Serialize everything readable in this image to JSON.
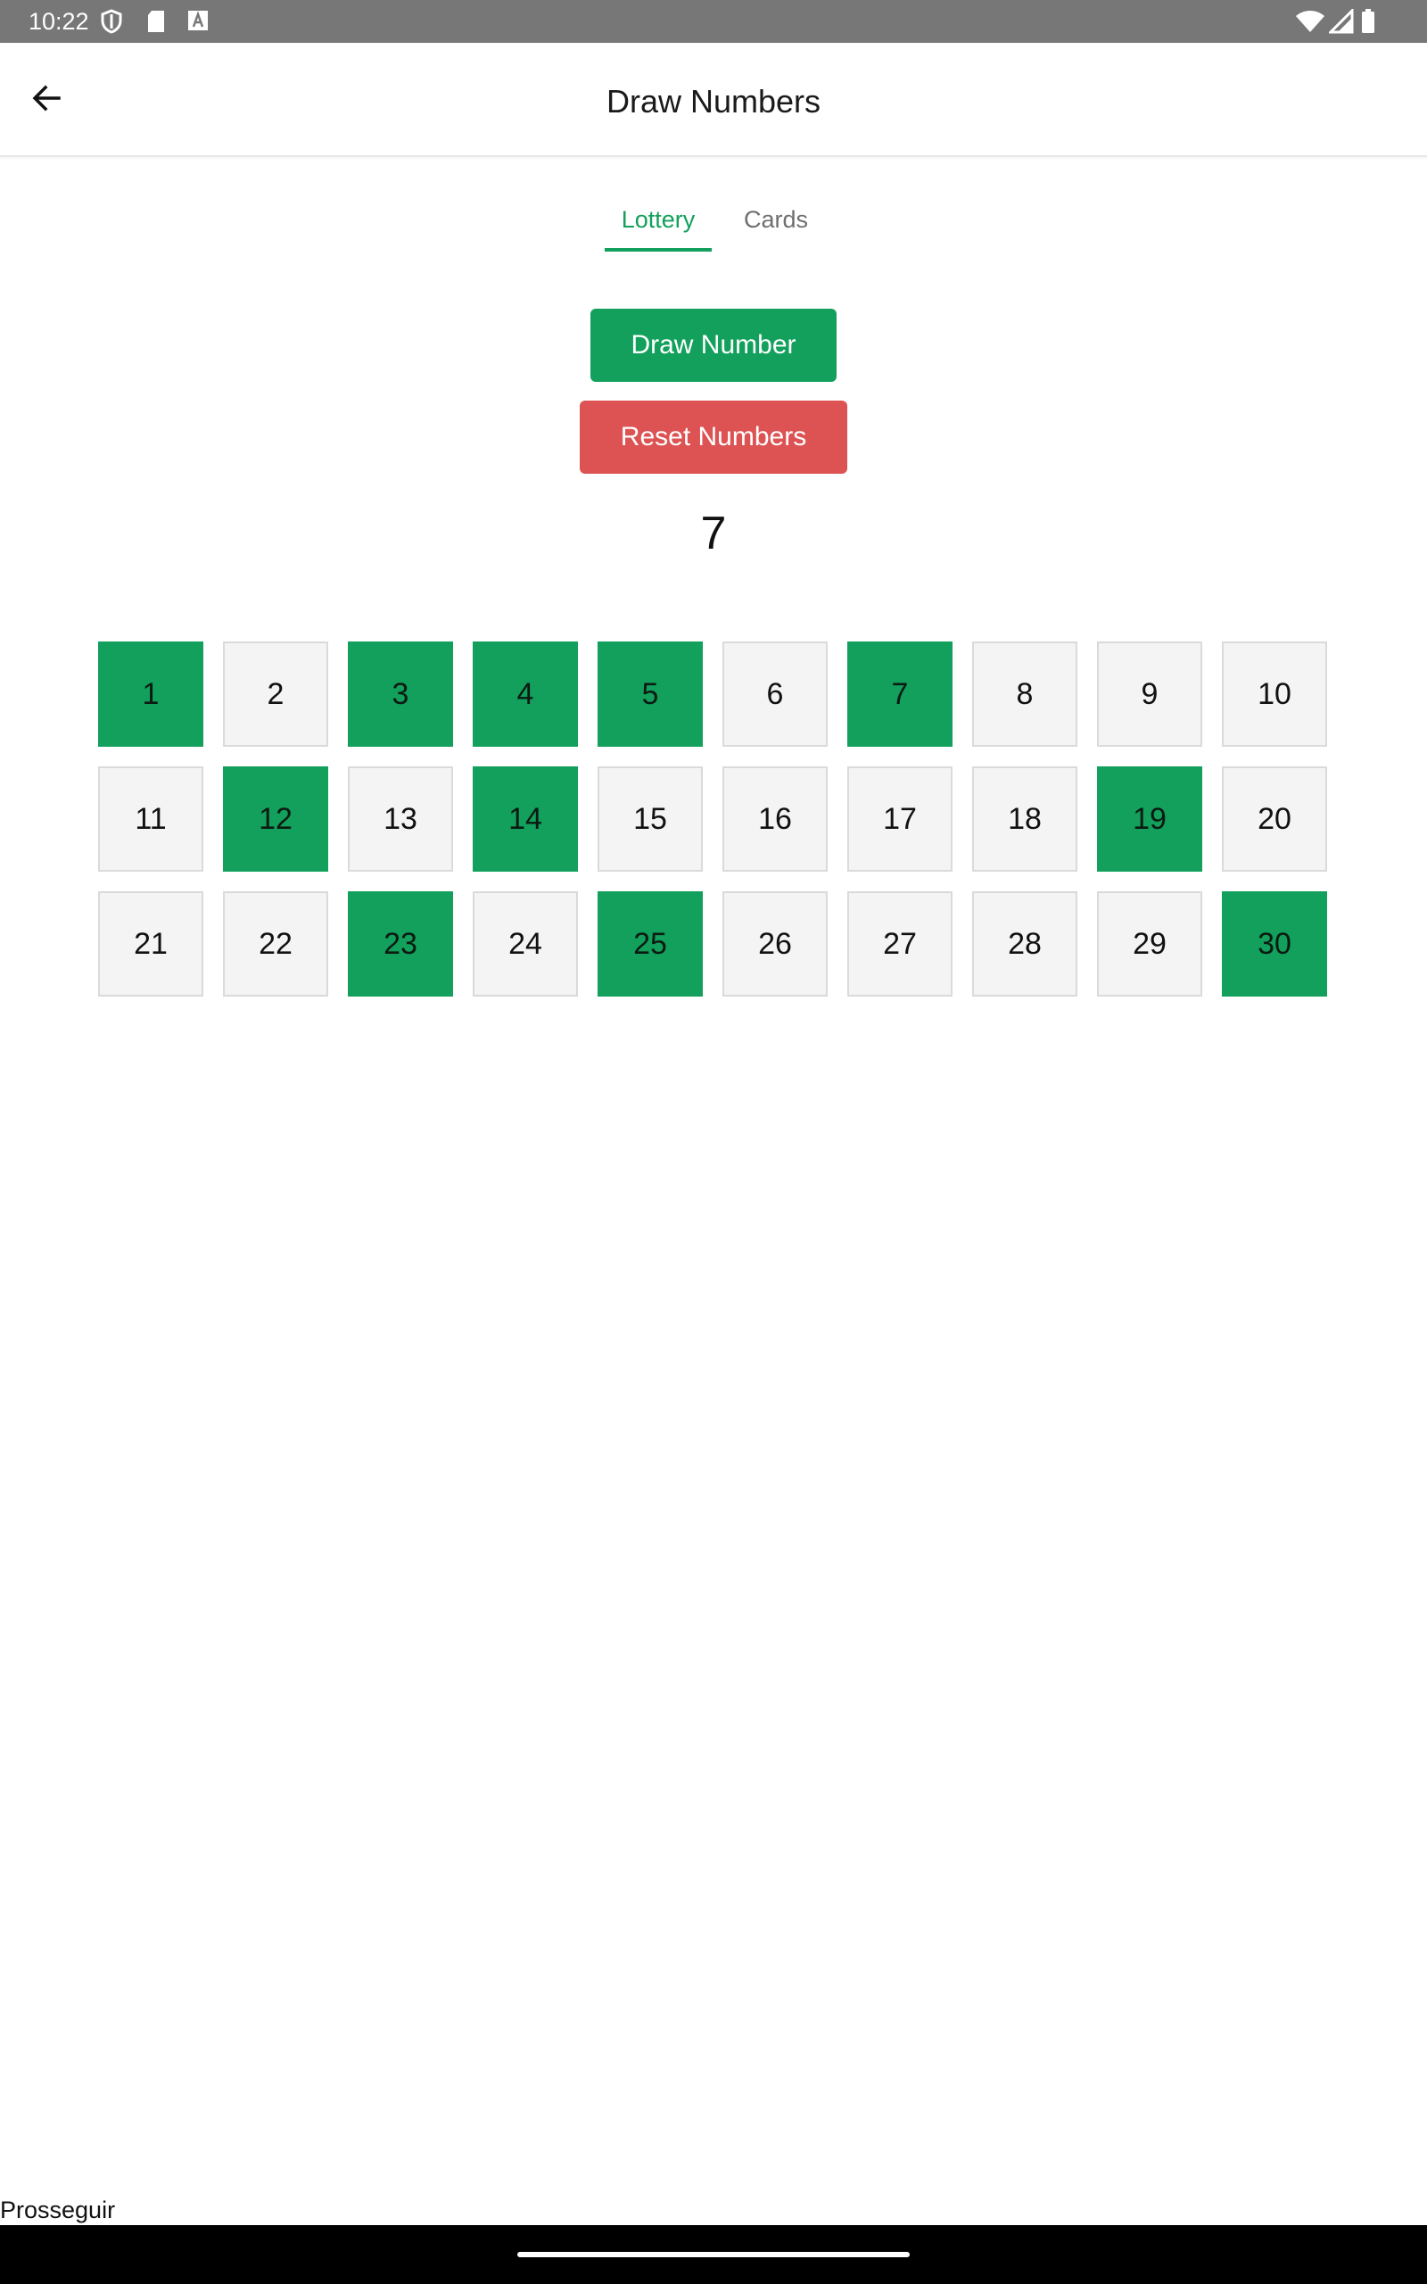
{
  "status_bar": {
    "time": "10:22",
    "left_icons": [
      "shield-icon",
      "sd-card-icon",
      "text-a-icon"
    ],
    "right_icons": [
      "wifi-icon",
      "signal-icon",
      "battery-icon"
    ]
  },
  "app_bar": {
    "title": "Draw Numbers",
    "back_icon": "arrow-left-icon"
  },
  "tabs": [
    {
      "label": "Lottery",
      "active": true
    },
    {
      "label": "Cards",
      "active": false
    }
  ],
  "actions": {
    "draw_label": "Draw Number",
    "reset_label": "Reset Numbers"
  },
  "current_number": "7",
  "numbers": [
    {
      "value": "1",
      "drawn": true
    },
    {
      "value": "2",
      "drawn": false
    },
    {
      "value": "3",
      "drawn": true
    },
    {
      "value": "4",
      "drawn": true
    },
    {
      "value": "5",
      "drawn": true
    },
    {
      "value": "6",
      "drawn": false
    },
    {
      "value": "7",
      "drawn": true
    },
    {
      "value": "8",
      "drawn": false
    },
    {
      "value": "9",
      "drawn": false
    },
    {
      "value": "10",
      "drawn": false
    },
    {
      "value": "11",
      "drawn": false
    },
    {
      "value": "12",
      "drawn": true
    },
    {
      "value": "13",
      "drawn": false
    },
    {
      "value": "14",
      "drawn": true
    },
    {
      "value": "15",
      "drawn": false
    },
    {
      "value": "16",
      "drawn": false
    },
    {
      "value": "17",
      "drawn": false
    },
    {
      "value": "18",
      "drawn": false
    },
    {
      "value": "19",
      "drawn": true
    },
    {
      "value": "20",
      "drawn": false
    },
    {
      "value": "21",
      "drawn": false
    },
    {
      "value": "22",
      "drawn": false
    },
    {
      "value": "23",
      "drawn": true
    },
    {
      "value": "24",
      "drawn": false
    },
    {
      "value": "25",
      "drawn": true
    },
    {
      "value": "26",
      "drawn": false
    },
    {
      "value": "27",
      "drawn": false
    },
    {
      "value": "28",
      "drawn": false
    },
    {
      "value": "29",
      "drawn": false
    },
    {
      "value": "30",
      "drawn": true
    }
  ],
  "footer": {
    "link_label": "Prosseguir"
  },
  "colors": {
    "accent_green": "#12a05c",
    "reset_red": "#dd5353",
    "cell_idle": "#f4f4f4"
  }
}
